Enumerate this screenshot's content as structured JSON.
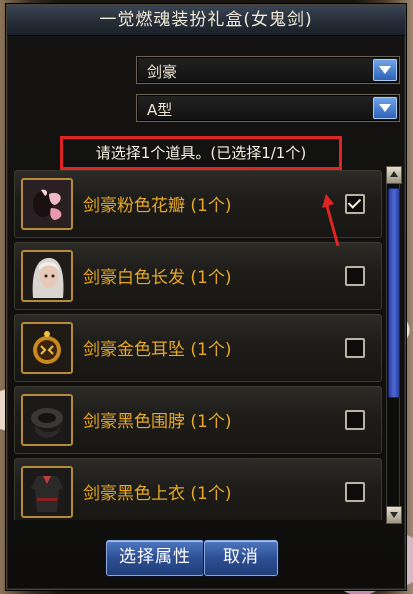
{
  "dialog": {
    "title": "一觉燃魂装扮礼盒(女鬼剑)"
  },
  "class_select": {
    "value": "剑豪"
  },
  "type_select": {
    "value": "A型"
  },
  "hint": "请选择1个道具。(已选择1/1个)",
  "items": [
    {
      "name": "剑豪粉色花瓣 (1个)",
      "checked": true,
      "icon": "pink-petal-icon"
    },
    {
      "name": "剑豪白色长发 (1个)",
      "checked": false,
      "icon": "white-hair-icon"
    },
    {
      "name": "剑豪金色耳坠 (1个)",
      "checked": false,
      "icon": "gold-earring-icon"
    },
    {
      "name": "剑豪黑色围脖 (1个)",
      "checked": false,
      "icon": "black-scarf-icon"
    },
    {
      "name": "剑豪黑色上衣 (1个)",
      "checked": false,
      "icon": "black-top-icon"
    }
  ],
  "buttons": {
    "select_attr": "选择属性",
    "cancel": "取消"
  },
  "colors": {
    "item_text": "#e8a826",
    "highlight_box": "#e02424",
    "button_blue": "#2d4f94"
  }
}
